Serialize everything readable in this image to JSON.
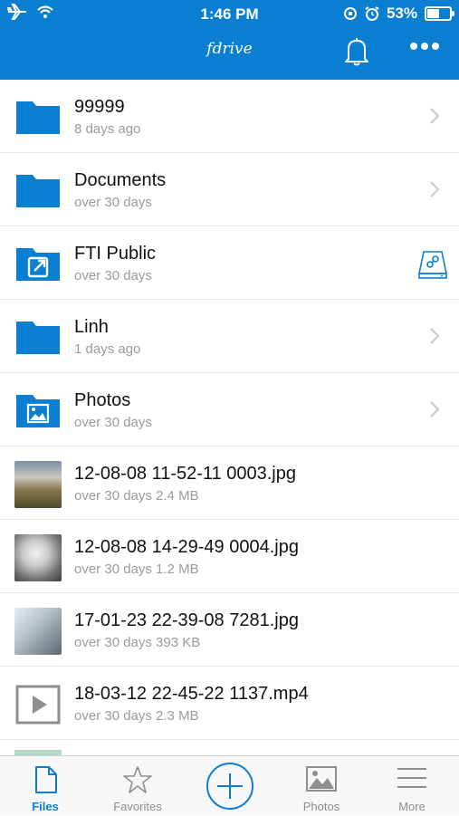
{
  "status_bar": {
    "time": "1:46 PM",
    "battery_pct": "53%",
    "battery_level": 0.53
  },
  "header": {
    "title": "fdrive",
    "bell_icon": "bell-icon",
    "more_icon": "more-horizontal-icon"
  },
  "files": [
    {
      "name": "99999",
      "meta": "8 days ago",
      "icon": "folder-icon",
      "type": "folder"
    },
    {
      "name": "Documents",
      "meta": "over 30 days",
      "icon": "folder-icon",
      "type": "folder"
    },
    {
      "name": "FTI Public",
      "meta": "over 30 days",
      "icon": "shared-folder-icon",
      "type": "shared-folder"
    },
    {
      "name": "Linh",
      "meta": "1 days ago",
      "icon": "folder-icon",
      "type": "folder"
    },
    {
      "name": "Photos",
      "meta": "over 30 days",
      "icon": "photos-folder-icon",
      "type": "folder"
    },
    {
      "name": "12-08-08 11-52-11 0003.jpg",
      "meta": "over 30 days 2.4 MB",
      "icon": "image-thumbnail",
      "type": "image"
    },
    {
      "name": "12-08-08 14-29-49 0004.jpg",
      "meta": "over 30 days 1.2 MB",
      "icon": "image-thumbnail",
      "type": "image"
    },
    {
      "name": "17-01-23 22-39-08 7281.jpg",
      "meta": "over 30 days 393 KB",
      "icon": "image-thumbnail",
      "type": "image"
    },
    {
      "name": "18-03-12 22-45-22 1137.mp4",
      "meta": "over 30 days 2.3 MB",
      "icon": "video-icon",
      "type": "video"
    }
  ],
  "tabs": [
    {
      "label": "Files",
      "icon": "file-icon",
      "active": true
    },
    {
      "label": "Favorites",
      "icon": "star-icon",
      "active": false
    },
    {
      "label": "",
      "icon": "add-circle-icon",
      "active": false
    },
    {
      "label": "Photos",
      "icon": "photo-icon",
      "active": false
    },
    {
      "label": "More",
      "icon": "menu-icon",
      "active": false
    }
  ],
  "colors": {
    "accent": "#0a7fd1",
    "meta_text": "#9b9b9b"
  }
}
